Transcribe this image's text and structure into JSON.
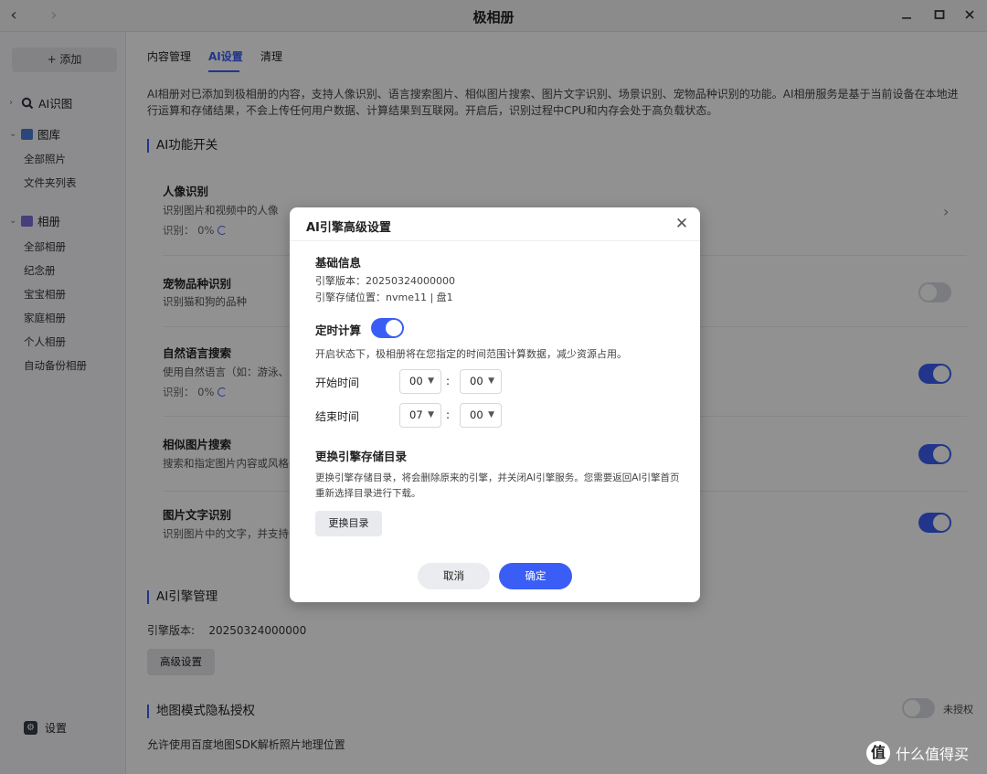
{
  "window": {
    "title": "极相册",
    "back_icon": "‹",
    "forward_icon": "›"
  },
  "sidebar": {
    "add_label": "+ 添加",
    "groups": [
      {
        "label": "AI识图",
        "icon": "search-icon"
      },
      {
        "label": "图库",
        "icon": "image-icon"
      },
      {
        "label": "相册",
        "icon": "album-icon"
      }
    ],
    "gallery_items": [
      "全部照片",
      "文件夹列表"
    ],
    "album_items": [
      "全部相册",
      "纪念册",
      "宝宝相册",
      "家庭相册",
      "个人相册",
      "自动备份相册"
    ],
    "settings_label": "设置"
  },
  "tabs": [
    "内容管理",
    "AI设置",
    "清理"
  ],
  "intro": "AI相册对已添加到极相册的内容，支持人像识别、语言搜索图片、相似图片搜索、图片文字识别、场景识别、宠物品种识别的功能。AI相册服务是基于当前设备在本地进行运算和存储结果，不会上传任何用户数据、计算结果到互联网。开启后，识别过程中CPU和内存会处于高负载状态。",
  "ai_switch_section": "AI功能开关",
  "features": [
    {
      "title": "人像识别",
      "desc": "识别图片和视频中的人像",
      "status": "识别： 0%"
    },
    {
      "title": "宠物品种识别",
      "desc": "识别猫和狗的品种",
      "enabled": false
    },
    {
      "title": "自然语言搜索",
      "desc": "使用自然语言（如：游泳、",
      "status": "识别： 0%",
      "enabled": true
    },
    {
      "title": "相似图片搜索",
      "desc": "搜索和指定图片内容或风格",
      "enabled": true
    },
    {
      "title": "图片文字识别",
      "desc": "识别图片中的文字，并支持",
      "enabled": true
    }
  ],
  "engine_section": "AI引擎管理",
  "engine_version_label": "引擎版本:",
  "engine_version": "20250324000000",
  "advanced_btn": "高级设置",
  "map_section": "地图模式隐私授权",
  "map_status": "未授权",
  "map_desc": "允许使用百度地图SDK解析照片地理位置",
  "dialog": {
    "title": "AI引擎高级设置",
    "basic_title": "基础信息",
    "engine_version_line": "引擎版本：20250324000000",
    "storage_line": "引擎存储位置：nvme11 | 盘1",
    "schedule_title": "定时计算",
    "schedule_enabled": true,
    "schedule_desc": "开启状态下，极相册将在您指定的时间范围计算数据，减少资源占用。",
    "start_label": "开始时间",
    "start_hour": "00",
    "start_min": "00",
    "end_label": "结束时间",
    "end_hour": "07",
    "end_min": "00",
    "colon": ":",
    "change_title": "更换引擎存储目录",
    "change_desc": "更换引擎存储目录，将会删除原来的引擎，并关闭AI引擎服务。您需要返回AI引擎首页重新选择目录进行下载。",
    "change_btn": "更换目录",
    "cancel_btn": "取消",
    "ok_btn": "确定"
  },
  "watermark": {
    "badge": "值",
    "text": "什么值得买"
  },
  "colors": {
    "accent": "#3a5ef5",
    "toggle_off": "#d9dbdf"
  }
}
